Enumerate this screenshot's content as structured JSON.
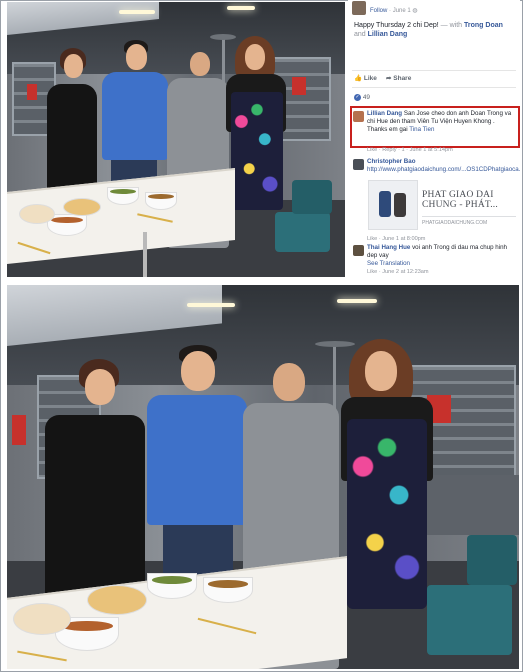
{
  "facebook_post": {
    "header_name": "",
    "follow_label": "Follow",
    "post_date": "June 1",
    "post_text": "Happy Thursday 2 chi Dep!",
    "tagged_prefix": "— with",
    "tagged_1": "Trong Doan",
    "tagged_joiner": "and",
    "tagged_2": "Lillian Dang",
    "like_label": "Like",
    "share_label": "Share",
    "reaction_count": "49",
    "comments": [
      {
        "name": "Lillian Dang",
        "text": "San Jose cheo don anh Doan Trong va chi Hue den tham Viên Tu Viện Huyen Khong . Thanks em gai",
        "tag": "Tina Tien",
        "footer": "Like · Reply · 1 · June 1 at 5:14pm"
      },
      {
        "name": "Christopher Bao",
        "text": "",
        "link": "http://www.phatgiaodaichung.com/...OS1CDPhatgiaoca...",
        "footer": "",
        "preview_title_1": "PHAT GIAO DAI",
        "preview_title_2": "CHUNG - PHÁT...",
        "preview_domain": "PHATGIAODAICHUNG.COM",
        "footer_after": "Like · June 1 at 8:00pm"
      },
      {
        "name": "Thai Hang Hue",
        "text": "voi anh Trong di dau ma chup hinh dep vay",
        "see_translation": "See Translation",
        "footer": "Like · June 2 at 12:23am"
      }
    ]
  },
  "colors": {
    "fb_blue": "#365899",
    "highlight_red": "#c8201d",
    "muted": "#90949c"
  }
}
